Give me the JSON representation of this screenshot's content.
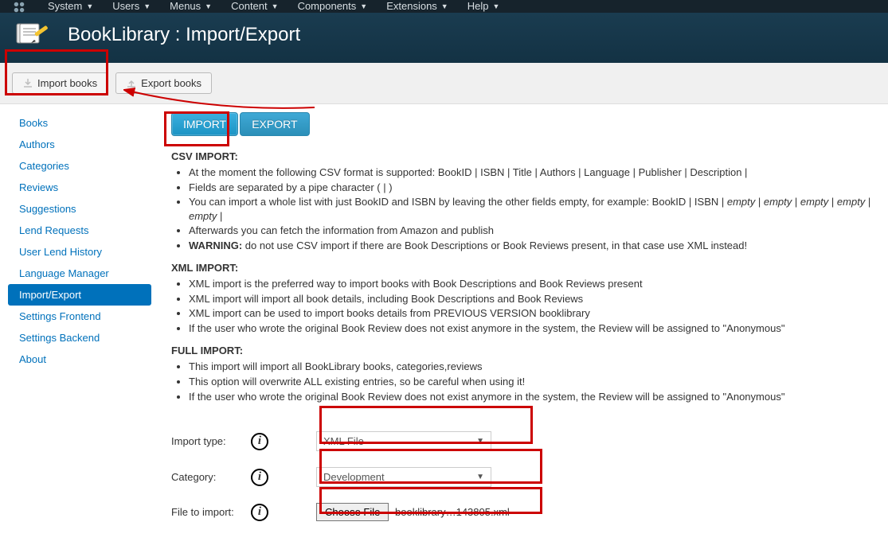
{
  "topbar": {
    "items": [
      "System",
      "Users",
      "Menus",
      "Content",
      "Components",
      "Extensions",
      "Help"
    ]
  },
  "header": {
    "title": "BookLibrary : Import/Export"
  },
  "toolbar": {
    "import_books": "Import books",
    "export_books": "Export books"
  },
  "sidebar": {
    "items": [
      "Books",
      "Authors",
      "Categories",
      "Reviews",
      "Suggestions",
      "Lend Requests",
      "User Lend History",
      "Language Manager",
      "Import/Export",
      "Settings Frontend",
      "Settings Backend",
      "About"
    ],
    "active_index": 8
  },
  "tabs": {
    "import": "IMPORT",
    "export": "EXPORT"
  },
  "sections": {
    "csv_head": "CSV IMPORT:",
    "csv_items": [
      "At the moment the following CSV format is supported:  BookID | ISBN | Title | Authors | Language | Publisher | Description |",
      "Fields are separated by a pipe character ( | )",
      "You can import a whole list with just BookID and ISBN by leaving the other fields empty, for example:  BookID | ISBN | ",
      "Afterwards you can fetch the information from Amazon and publish",
      " do not use CSV import if there are Book Descriptions or Book Reviews present, in that case use XML instead!"
    ],
    "csv_warning_label": "WARNING:",
    "csv_empty": "empty",
    "xml_head": "XML IMPORT:",
    "xml_items": [
      "XML import is the preferred way to import books with Book Descriptions and Book Reviews present",
      "XML import will import all book details, including Book Descriptions and Book Reviews",
      "XML import can be used to import books details from PREVIOUS VERSION booklibrary",
      "If the user who wrote the original Book Review does not exist anymore in the system, the Review will be assigned to \"Anonymous\""
    ],
    "full_head": "FULL IMPORT:",
    "full_items": [
      "This import will import all BookLibrary books, categories,reviews",
      "This option will overwrite ALL existing entries, so be careful when using it!",
      "If the user who wrote the original Book Review does not exist anymore in the system, the Review will be assigned to \"Anonymous\""
    ]
  },
  "form": {
    "import_type_label": "Import type:",
    "import_type_value": "XML File",
    "category_label": "Category:",
    "category_value": "Development",
    "file_label": "File to import:",
    "choose_file_btn": "Choose File",
    "file_name": "booklibrary…143805.xml"
  }
}
